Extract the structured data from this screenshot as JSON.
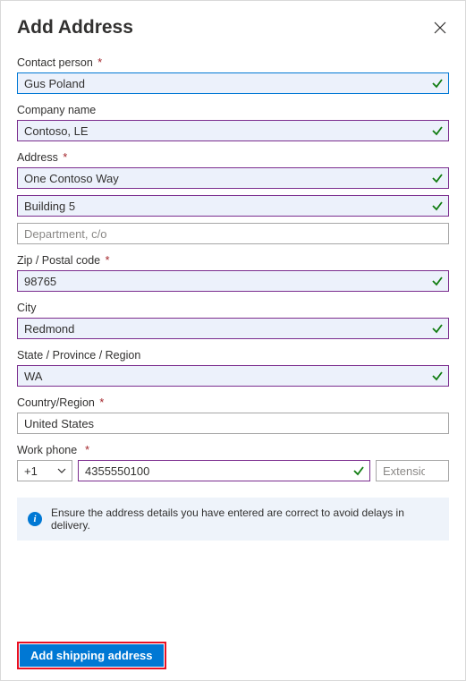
{
  "title": "Add Address",
  "fields": {
    "contact": {
      "label": "Contact person",
      "required": true,
      "value": "Gus Poland"
    },
    "company": {
      "label": "Company name",
      "required": false,
      "value": "Contoso, LE"
    },
    "address": {
      "label": "Address",
      "required": true,
      "line1": "One Contoso Way",
      "line2": "Building 5",
      "line3_placeholder": "Department, c/o"
    },
    "zip": {
      "label": "Zip / Postal code",
      "required": true,
      "value": "98765"
    },
    "city": {
      "label": "City",
      "required": false,
      "value": "Redmond"
    },
    "state": {
      "label": "State / Province / Region",
      "required": false,
      "value": "WA"
    },
    "country": {
      "label": "Country/Region",
      "required": true,
      "value": "United States"
    },
    "phone": {
      "label": "Work phone",
      "required": true,
      "cc": "+1",
      "number": "4355550100",
      "ext_placeholder": "Extension"
    }
  },
  "info": "Ensure the address details you have entered are correct to avoid delays in delivery.",
  "submit": "Add shipping address"
}
